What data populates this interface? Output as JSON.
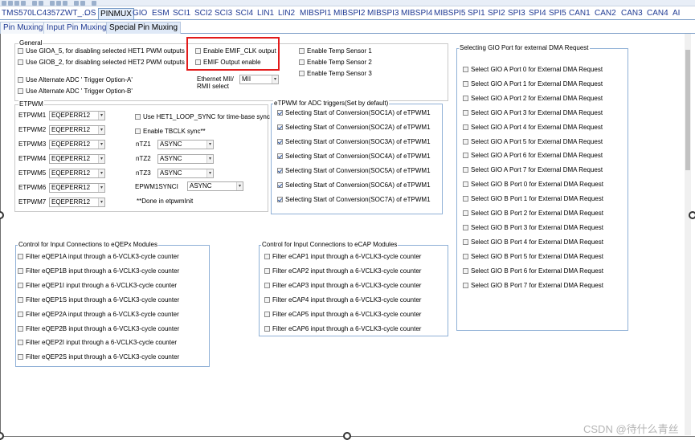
{
  "tabs": [
    "TMS570LC4357ZWT_...",
    "OS",
    "PINMUX",
    "GIO",
    "ESM",
    "SCI1",
    "SCI2",
    "SCI3",
    "SCI4",
    "LIN1",
    "LIN2",
    "MIBSPI1",
    "MIBSPI2",
    "MIBSPI3",
    "MIBSPI4",
    "MIBSPI5",
    "SPI1",
    "SPI2",
    "SPI3",
    "SPI4",
    "SPI5",
    "CAN1",
    "CAN2",
    "CAN3",
    "CAN4",
    "AI"
  ],
  "active_tab": "PINMUX",
  "subtabs": [
    "Pin Muxing",
    "Input Pin Muxing",
    "Special Pin Muxing"
  ],
  "active_subtab": "Special Pin Muxing",
  "general": {
    "title": "General",
    "checkboxes": [
      {
        "label": "Use GIOA_5, for disabling selected HET1 PWM outputs",
        "checked": false
      },
      {
        "label": "Use GIOB_2, for disabling selected HET2 PWM outputs",
        "checked": false
      },
      {
        "label": "Use Alternate ADC ' Trigger Option-A'",
        "checked": false
      },
      {
        "label": "Use Alternate ADC ' Trigger Option-B'",
        "checked": false
      }
    ],
    "emif_checkboxes": [
      {
        "label": "Enable EMIF_CLK output",
        "checked": false
      },
      {
        "label": "EMIF Output enable",
        "checked": false
      }
    ],
    "temp_checkboxes": [
      {
        "label": "Enable Temp Sensor 1",
        "checked": false
      },
      {
        "label": "Enable Temp Sensor 2",
        "checked": false
      },
      {
        "label": "Enable Temp Sensor 3",
        "checked": false
      }
    ],
    "ethernet_label_1": "Ethernet MII/",
    "ethernet_label_2": "RMII select",
    "ethernet_value": "MII"
  },
  "etpwm": {
    "title": "ETPWM",
    "rows": [
      {
        "label": "ETPWM1",
        "value": "EQEPERR12"
      },
      {
        "label": "ETPWM2",
        "value": "EQEPERR12"
      },
      {
        "label": "ETPWM3",
        "value": "EQEPERR12"
      },
      {
        "label": "ETPWM4",
        "value": "EQEPERR12"
      },
      {
        "label": "ETPWM5",
        "value": "EQEPERR12"
      },
      {
        "label": "ETPWM6",
        "value": "EQEPERR12"
      },
      {
        "label": "ETPWM7",
        "value": "EQEPERR12"
      }
    ],
    "loop_sync_label": "Use HET1_LOOP_SYNC for time-base sync",
    "tbclk_label": "Enable TBCLK sync**",
    "tz": [
      {
        "label": "nTZ1",
        "value": "ASYNC"
      },
      {
        "label": "nTZ2",
        "value": "ASYNC"
      },
      {
        "label": "nTZ3",
        "value": "ASYNC"
      }
    ],
    "synci_label": "EPWM1SYNCI",
    "synci_value": "ASYNC",
    "note": "**Done in etpwmInit"
  },
  "adc_triggers": {
    "title": "eTPWM for ADC triggers(Set by default)",
    "items": [
      "Selecting Start of Conversion(SOC1A) of eTPWM1",
      "Selecting Start of Conversion(SOC2A) of eTPWM1",
      "Selecting Start of Conversion(SOC3A) of eTPWM1",
      "Selecting Start of Conversion(SOC4A) of eTPWM1",
      "Selecting Start of Conversion(SOC5A) of eTPWM1",
      "Selecting Start of Conversion(SOC6A) of eTPWM1",
      "Selecting Start of Conversion(SOC7A) of eTPWM1"
    ]
  },
  "dma": {
    "title": "Selecting GIO Port for external DMA Request",
    "items": [
      "Select GIO A Port 0 for External DMA Request",
      "Select GIO A Port 1 for External DMA Request",
      "Select GIO A Port 2 for External DMA Request",
      "Select GIO A Port 3 for External DMA Request",
      "Select GIO A Port 4 for External DMA Request",
      "Select GIO A Port 5 for External DMA Request",
      "Select GIO A Port 6 for External DMA Request",
      "Select GIO A Port 7 for External DMA Request",
      "Select GIO B Port 0 for External DMA Request",
      "Select GIO B Port 1 for External DMA Request",
      "Select GIO B Port 2 for External DMA Request",
      "Select GIO B Port 3 for External DMA Request",
      "Select GIO B Port 4 for External DMA Request",
      "Select GIO B Port 5 for External DMA Request",
      "Select GIO B Port 6 for External DMA Request",
      "Select GIO B Port 7 for External DMA Request"
    ]
  },
  "eqep": {
    "title": "Control for Input Connections to eQEPx Modules",
    "items": [
      "Filter eQEP1A input through a 6-VCLK3-cycle counter",
      "Filter eQEP1B input through a 6-VCLK3-cycle counter",
      "Filter eQEP1I input through a 6-VCLK3-cycle counter",
      "Filter eQEP1S input through a 6-VCLK3-cycle counter",
      "Filter eQEP2A input through a 6-VCLK3-cycle counter",
      "Filter eQEP2B input through a 6-VCLK3-cycle counter",
      "Filter eQEP2I input through a 6-VCLK3-cycle counter",
      "Filter eQEP2S input through a 6-VCLK3-cycle counter"
    ]
  },
  "ecap": {
    "title": "Control for Input Connections to eCAP Modules",
    "items": [
      "Filter eCAP1 input through a 6-VCLK3-cycle counter",
      "Filter eCAP2 input through a 6-VCLK3-cycle counter",
      "Filter eCAP3 input through a 6-VCLK3-cycle counter",
      "Filter eCAP4 input through a 6-VCLK3-cycle counter",
      "Filter eCAP5 input through a 6-VCLK3-cycle counter",
      "Filter eCAP6 input through a 6-VCLK3-cycle counter"
    ]
  },
  "watermark": "CSDN @待什么青丝",
  "colors": {
    "highlight": "#e21b1b",
    "tab_text": "#1f3a93",
    "group_border": "#8fb0d6"
  }
}
